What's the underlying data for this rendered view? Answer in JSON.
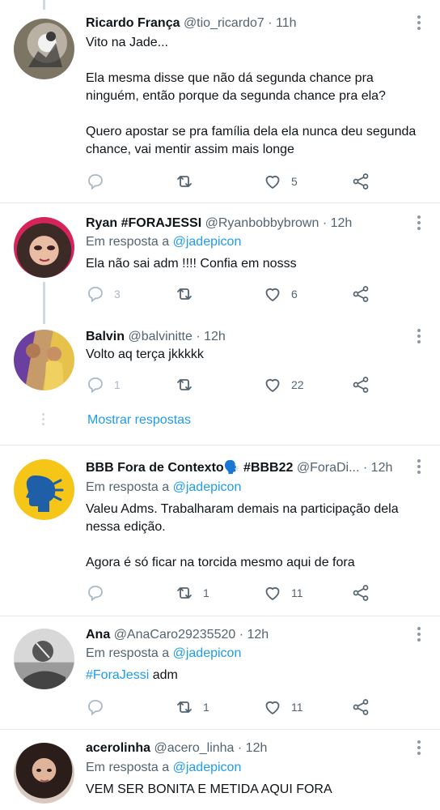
{
  "tweets": [
    {
      "name": "Ricardo França",
      "handle": "@tio_ricardo7",
      "time": "· 11h",
      "reply_label": "",
      "reply_handle": "",
      "text": "Vito na Jade...\n\nEla mesma disse que não dá segunda chance pra ninguém, então porque da segunda chance pra ela?\n\nQuero apostar se pra família dela ela nunca deu segunda chance, vai mentir assim mais longe",
      "replies": "",
      "retweets": "",
      "likes": "5"
    },
    {
      "name": "Ryan #FORAJESSI",
      "handle": "@Ryanbobbybrown",
      "time": "· 12h",
      "reply_label": "Em resposta a",
      "reply_handle": "@jadepicon",
      "text": "Ela não sai adm !!!! Confia em nosss",
      "replies": "3",
      "retweets": "",
      "likes": "6"
    },
    {
      "name": "Balvin",
      "handle": "@balvinitte",
      "time": "· 12h",
      "reply_label": "",
      "reply_handle": "",
      "text": "Volto aq terça jkkkkk",
      "replies": "1",
      "retweets": "",
      "likes": "22"
    },
    {
      "name": "BBB Fora de Contexto🗣️ #BBB22",
      "handle": "@ForaDi...",
      "time": "· 12h",
      "reply_label": "Em resposta a",
      "reply_handle": "@jadepicon",
      "text": "Valeu Adms. Trabalharam demais na participação dela nessa edição.\n\nAgora é só ficar na torcida mesmo aqui de fora",
      "replies": "",
      "retweets": "1",
      "likes": "11"
    },
    {
      "name": "Ana",
      "handle": "@AnaCaro29235520",
      "time": "· 12h",
      "reply_label": "Em resposta a",
      "reply_handle": "@jadepicon",
      "text_hashtag": "#ForaJessi",
      "text_rest": " adm",
      "replies": "",
      "retweets": "1",
      "likes": "11"
    },
    {
      "name": "acerolinha",
      "handle": "@acero_linha",
      "time": "· 12h",
      "reply_label": "Em resposta a",
      "reply_handle": "@jadepicon",
      "text": "VEM SER BONITA E METIDA AQUI FORA"
    }
  ],
  "show_replies": "Mostrar respostas",
  "colors": {
    "accent": "#1d9bf0",
    "muted": "#536471",
    "separator": "#e1e8ed"
  }
}
